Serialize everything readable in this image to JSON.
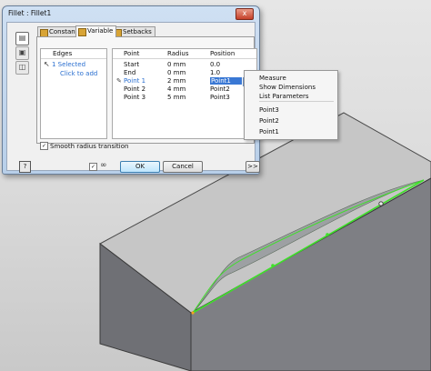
{
  "dialog": {
    "title": "Fillet : Fillet1",
    "close_label": "x",
    "tabs": [
      {
        "label": "Constant"
      },
      {
        "label": "Variable"
      },
      {
        "label": "Setbacks"
      }
    ],
    "edges": {
      "header": "Edges",
      "selected": "1 Selected",
      "click_to_add": "Click to add"
    },
    "points_table": {
      "columns": [
        "Point",
        "Radius",
        "Position"
      ],
      "rows": [
        {
          "point": "Start",
          "radius": "0 mm",
          "position": "0.0"
        },
        {
          "point": "End",
          "radius": "0 mm",
          "position": "1.0"
        },
        {
          "point": "Point 1",
          "radius": "2 mm",
          "position": "Point1"
        },
        {
          "point": "Point 2",
          "radius": "4 mm",
          "position": "Point2"
        },
        {
          "point": "Point 3",
          "radius": "5 mm",
          "position": "Point3"
        }
      ]
    },
    "smooth_radius_label": "Smooth radius transition",
    "smooth_radius_checked": true,
    "preview_checked": true,
    "ok_label": "OK",
    "cancel_label": "Cancel",
    "more_label": ">>",
    "help_label": "?"
  },
  "context_menu": {
    "items": [
      {
        "label": "Measure"
      },
      {
        "label": "Show Dimensions"
      },
      {
        "label": "List Parameters"
      },
      {
        "label": "Point3"
      },
      {
        "label": "Point2"
      },
      {
        "label": "Point1"
      }
    ]
  },
  "colors": {
    "edge_highlight": "#3fe02a",
    "selection_blue": "#3a78d4",
    "link_blue": "#2a6fd0"
  }
}
